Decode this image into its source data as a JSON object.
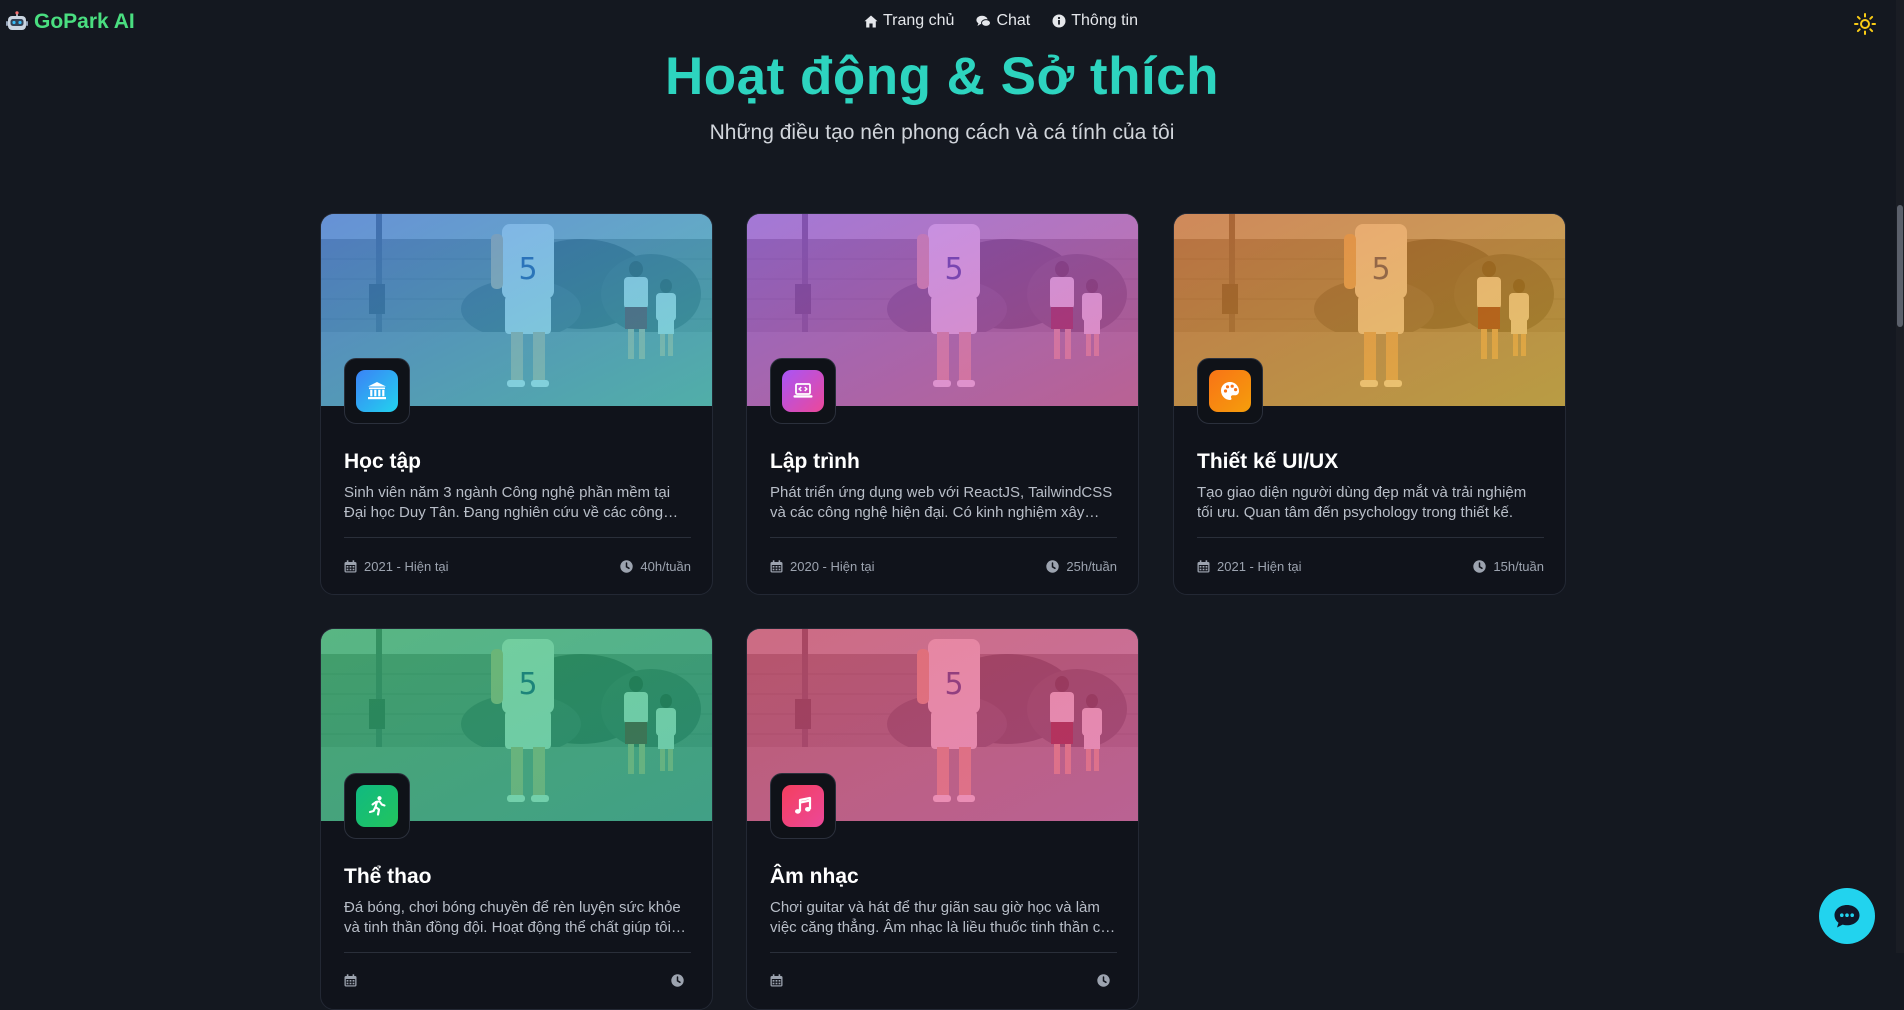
{
  "brand": {
    "name": "GoPark AI",
    "icon": "robot-icon",
    "color": "#4ade80"
  },
  "nav": {
    "items": [
      {
        "label": "Trang chủ",
        "icon": "home-icon"
      },
      {
        "label": "Chat",
        "icon": "chat-icon"
      },
      {
        "label": "Thông tin",
        "icon": "info-icon"
      }
    ]
  },
  "theme_toggle": {
    "icon": "sun-icon",
    "color": "#facc15"
  },
  "header": {
    "title": "Hoạt động & Sở thích",
    "subtitle": "Những điều tạo nên phong cách và cá tính của tôi",
    "title_color": "#2dd4bf"
  },
  "cards": [
    {
      "title": "Học tập",
      "description": "Sinh viên năm 3 ngành Công nghệ phần mềm tại Đại học Duy Tân. Đang nghiên cứu về các công nghệ mới.",
      "period": "2021 - Hiện tại",
      "hours": "40h/tuần",
      "icon": "university-icon",
      "icon_colors": [
        "#3b82f6",
        "#22d3ee"
      ],
      "overlay_colors": [
        "#3b82f6",
        "#2dd4bf"
      ]
    },
    {
      "title": "Lập trình",
      "description": "Phát triển ứng dụng web với ReactJS, TailwindCSS và các công nghệ hiện đại. Có kinh nghiệm xây dựng nhiều dự án.",
      "period": "2020 - Hiện tại",
      "hours": "25h/tuần",
      "icon": "laptop-code-icon",
      "icon_colors": [
        "#a855f7",
        "#ec4899"
      ],
      "overlay_colors": [
        "#a855f7",
        "#ec4899"
      ]
    },
    {
      "title": "Thiết kế UI/UX",
      "description": "Tạo giao diện người dùng đẹp mắt và trải nghiệm tối ưu. Quan tâm đến psychology trong thiết kế.",
      "period": "2021 - Hiện tại",
      "hours": "15h/tuần",
      "icon": "palette-icon",
      "icon_colors": [
        "#f97316",
        "#f59e0b"
      ],
      "overlay_colors": [
        "#f97316",
        "#eab308"
      ]
    },
    {
      "title": "Thể thao",
      "description": "Đá bóng, chơi bóng chuyền để rèn luyện sức khỏe và tinh thần đồng đội. Hoạt động thể chất giúp tôi cân bằng.",
      "period": "",
      "hours": "",
      "icon": "running-icon",
      "icon_colors": [
        "#10b981",
        "#22c55e"
      ],
      "overlay_colors": [
        "#22c55e",
        "#10b981"
      ]
    },
    {
      "title": "Âm nhạc",
      "description": "Chơi guitar và hát để thư giãn sau giờ học và làm việc căng thẳng. Âm nhạc là liều thuốc tinh thần của tôi.",
      "period": "",
      "hours": "",
      "icon": "music-icon",
      "icon_colors": [
        "#f43f5e",
        "#ec4899"
      ],
      "overlay_colors": [
        "#f43f5e",
        "#ec4899"
      ]
    }
  ],
  "chat_fab": {
    "icon": "chat-bubble-icon",
    "color": "#22d3ee"
  }
}
